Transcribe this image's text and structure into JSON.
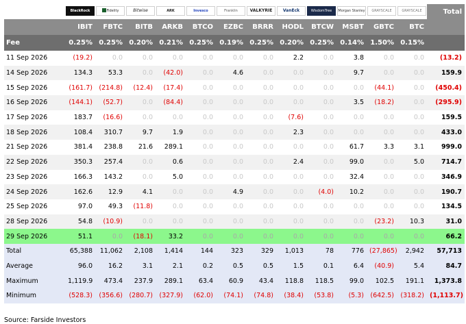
{
  "chart_data": {
    "type": "table",
    "logos": [
      {
        "issuer": "iShares BlackRock",
        "text": "BlackRock",
        "style": "lg-ishares",
        "icon": "ishares-logo-icon"
      },
      {
        "issuer": "Fidelity",
        "text": "Fidelity",
        "style": "lg-fidelity",
        "icon": "fidelity-logo-icon"
      },
      {
        "issuer": "Bitwise",
        "text": "Bitwise",
        "style": "lg-bitwise",
        "icon": "bitwise-logo-icon"
      },
      {
        "issuer": "ARK 21Shares",
        "text": "ARK",
        "style": "lg-ark",
        "icon": "ark-logo-icon"
      },
      {
        "issuer": "Invesco",
        "text": "Invesco",
        "style": "lg-invesco",
        "icon": "invesco-logo-icon"
      },
      {
        "issuer": "Franklin Templeton",
        "text": "Franklin",
        "style": "lg-franklin",
        "icon": "franklin-logo-icon"
      },
      {
        "issuer": "Valkyrie",
        "text": "VALKYRIE",
        "style": "lg-valkyrie",
        "icon": "valkyrie-logo-icon"
      },
      {
        "issuer": "VanEck",
        "text": "VanEck",
        "style": "lg-vaneck",
        "icon": "vaneck-logo-icon"
      },
      {
        "issuer": "WisdomTree",
        "text": "WisdomTree",
        "style": "lg-wisdomtree",
        "icon": "wisdomtree-logo-icon"
      },
      {
        "issuer": "Morgan Stanley",
        "text": "Morgan Stanley",
        "style": "lg-morgan",
        "icon": "morgan-stanley-logo-icon"
      },
      {
        "issuer": "Grayscale",
        "text": "GRAYSCALE",
        "style": "lg-grayscale",
        "icon": "grayscale-logo-icon"
      },
      {
        "issuer": "Grayscale",
        "text": "GRAYSCALE",
        "style": "lg-grayscale",
        "icon": "grayscale-logo-icon"
      }
    ],
    "total_header": "Total",
    "tickers": [
      "IBIT",
      "FBTC",
      "BITB",
      "ARKB",
      "BTCO",
      "EZBC",
      "BRRR",
      "HODL",
      "BTCW",
      "MSBT",
      "GBTC",
      "BTC"
    ],
    "fee_label": "Fee",
    "fees": [
      "0.25%",
      "0.25%",
      "0.20%",
      "0.21%",
      "0.25%",
      "0.19%",
      "0.25%",
      "0.20%",
      "0.25%",
      "0.14%",
      "1.50%",
      "0.15%"
    ],
    "rows": [
      {
        "date": "11 Sep 2026",
        "values": [
          "(19.2)",
          "0.0",
          "0.0",
          "0.0",
          "0.0",
          "0.0",
          "0.0",
          "2.2",
          "0.0",
          "3.8",
          "0.0",
          "0.0"
        ],
        "total": "(13.2)"
      },
      {
        "date": "14 Sep 2026",
        "values": [
          "134.3",
          "53.3",
          "0.0",
          "(42.0)",
          "0.0",
          "4.6",
          "0.0",
          "0.0",
          "0.0",
          "9.7",
          "0.0",
          "0.0"
        ],
        "total": "159.9"
      },
      {
        "date": "15 Sep 2026",
        "values": [
          "(161.7)",
          "(214.8)",
          "(12.4)",
          "(17.4)",
          "0.0",
          "0.0",
          "0.0",
          "0.0",
          "0.0",
          "0.0",
          "(44.1)",
          "0.0"
        ],
        "total": "(450.4)"
      },
      {
        "date": "16 Sep 2026",
        "values": [
          "(144.1)",
          "(52.7)",
          "0.0",
          "(84.4)",
          "0.0",
          "0.0",
          "0.0",
          "0.0",
          "0.0",
          "3.5",
          "(18.2)",
          "0.0"
        ],
        "total": "(295.9)"
      },
      {
        "date": "17 Sep 2026",
        "values": [
          "183.7",
          "(16.6)",
          "0.0",
          "0.0",
          "0.0",
          "0.0",
          "0.0",
          "(7.6)",
          "0.0",
          "0.0",
          "0.0",
          "0.0"
        ],
        "total": "159.5"
      },
      {
        "date": "18 Sep 2026",
        "values": [
          "108.4",
          "310.7",
          "9.7",
          "1.9",
          "0.0",
          "0.0",
          "0.0",
          "2.3",
          "0.0",
          "0.0",
          "0.0",
          "0.0"
        ],
        "total": "433.0"
      },
      {
        "date": "21 Sep 2026",
        "values": [
          "381.4",
          "238.8",
          "21.6",
          "289.1",
          "0.0",
          "0.0",
          "0.0",
          "0.0",
          "0.0",
          "61.7",
          "3.3",
          "3.1"
        ],
        "total": "999.0"
      },
      {
        "date": "22 Sep 2026",
        "values": [
          "350.3",
          "257.4",
          "0.0",
          "0.6",
          "0.0",
          "0.0",
          "0.0",
          "2.4",
          "0.0",
          "99.0",
          "0.0",
          "5.0"
        ],
        "total": "714.7"
      },
      {
        "date": "23 Sep 2026",
        "values": [
          "166.3",
          "143.2",
          "0.0",
          "5.0",
          "0.0",
          "0.0",
          "0.0",
          "0.0",
          "0.0",
          "32.4",
          "0.0",
          "0.0"
        ],
        "total": "346.9"
      },
      {
        "date": "24 Sep 2026",
        "values": [
          "162.6",
          "12.9",
          "4.1",
          "0.0",
          "0.0",
          "4.9",
          "0.0",
          "0.0",
          "(4.0)",
          "10.2",
          "0.0",
          "0.0"
        ],
        "total": "190.7"
      },
      {
        "date": "25 Sep 2026",
        "values": [
          "97.0",
          "49.3",
          "(11.8)",
          "0.0",
          "0.0",
          "0.0",
          "0.0",
          "0.0",
          "0.0",
          "0.0",
          "0.0",
          "0.0"
        ],
        "total": "134.5"
      },
      {
        "date": "28 Sep 2026",
        "values": [
          "54.8",
          "(10.9)",
          "0.0",
          "0.0",
          "0.0",
          "0.0",
          "0.0",
          "0.0",
          "0.0",
          "0.0",
          "(23.2)",
          "10.3"
        ],
        "total": "31.0"
      },
      {
        "date": "29 Sep 2026",
        "values": [
          "51.1",
          "0.0",
          "(18.1)",
          "33.2",
          "0.0",
          "0.0",
          "0.0",
          "0.0",
          "0.0",
          "0.0",
          "0.0",
          "0.0"
        ],
        "total": "66.2",
        "highlight": true
      }
    ],
    "summary": [
      {
        "label": "Total",
        "values": [
          "65,388",
          "11,062",
          "2,108",
          "1,414",
          "144",
          "323",
          "329",
          "1,013",
          "78",
          "776",
          "(27,865)",
          "2,942"
        ],
        "total": "57,713"
      },
      {
        "label": "Average",
        "values": [
          "96.0",
          "16.2",
          "3.1",
          "2.1",
          "0.2",
          "0.5",
          "0.5",
          "1.5",
          "0.1",
          "6.4",
          "(40.9)",
          "5.4"
        ],
        "total": "84.7"
      },
      {
        "label": "Maximum",
        "values": [
          "1,119.9",
          "473.4",
          "237.9",
          "289.1",
          "63.4",
          "60.9",
          "43.4",
          "118.8",
          "118.5",
          "99.0",
          "102.5",
          "191.1"
        ],
        "total": "1,373.8"
      },
      {
        "label": "Minimum",
        "values": [
          "(528.3)",
          "(356.6)",
          "(280.7)",
          "(327.9)",
          "(62.0)",
          "(74.1)",
          "(74.8)",
          "(38.4)",
          "(53.8)",
          "(5.3)",
          "(642.5)",
          "(318.2)"
        ],
        "total": "(1,113.7)"
      }
    ],
    "source": "Source: Farside Investors",
    "colors": {
      "negative": "#e00000",
      "zero": "#c8c8c8",
      "highlight": "#8cf78c",
      "header": "#8c8c8c",
      "fee_row": "#6e6e6e",
      "summary": "#e3e8f6"
    }
  }
}
